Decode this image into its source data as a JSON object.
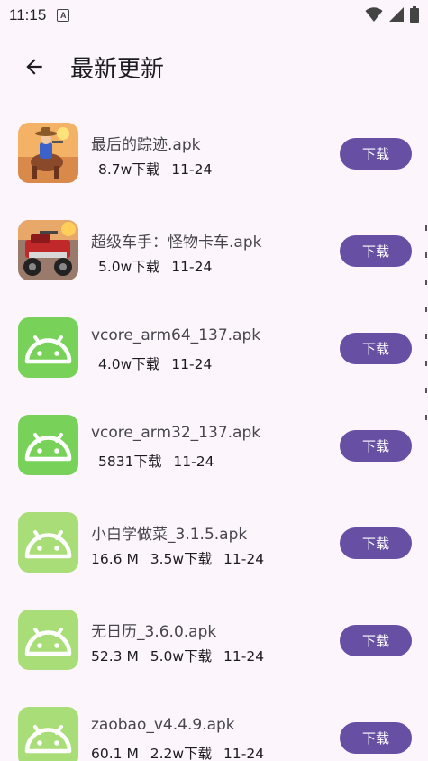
{
  "status_bar": {
    "time": "11:15",
    "indicator_letter": "A",
    "icons": [
      "wifi-icon",
      "cellular-signal-icon",
      "battery-icon"
    ]
  },
  "app_bar": {
    "back_icon": "arrow-back-icon",
    "title": "最新更新"
  },
  "colors": {
    "background": "#fcf6fc",
    "button": "#6750a4",
    "android_icon_green": "#78d25a",
    "android_icon_light_green": "#a8dd78"
  },
  "files": [
    {
      "name": "最后的踪迹.apk",
      "size": "",
      "downloads": "8.7w下载",
      "date": "11-24",
      "icon": "game-cowboy-icon",
      "button": "下载"
    },
    {
      "name": "超级车手：怪物卡车.apk",
      "size": "",
      "downloads": "5.0w下载",
      "date": "11-24",
      "icon": "game-monster-truck-icon",
      "button": "下载"
    },
    {
      "name": "vcore_arm64_137.apk",
      "size": "",
      "downloads": "4.0w下载",
      "date": "11-24",
      "icon": "android-icon",
      "button": "下载"
    },
    {
      "name": "vcore_arm32_137.apk",
      "size": "",
      "downloads": "5831下载",
      "date": "11-24",
      "icon": "android-icon",
      "button": "下载"
    },
    {
      "name": "小白学做菜_3.1.5.apk",
      "size": "16.6 M",
      "downloads": "3.5w下载",
      "date": "11-24",
      "icon": "android-icon-light",
      "button": "下载"
    },
    {
      "name": "无日历_3.6.0.apk",
      "size": "52.3 M",
      "downloads": "5.0w下载",
      "date": "11-24",
      "icon": "android-icon-light",
      "button": "下载"
    },
    {
      "name": "zaobao_v4.4.9.apk",
      "size": "60.1 M",
      "downloads": "2.2w下载",
      "date": "11-24",
      "icon": "android-icon-light",
      "button": "下载"
    }
  ]
}
